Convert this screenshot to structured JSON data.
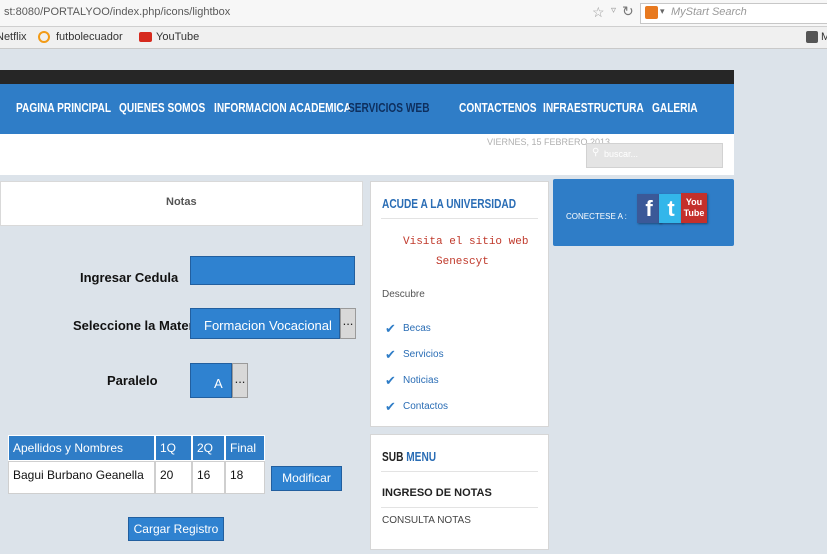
{
  "browser": {
    "url": "st:8080/PORTALYOO/index.php/icons/lightbox",
    "search_placeholder": "MyStart Search",
    "bookmarks": [
      "Netflix",
      "futbolecuador",
      "YouTube",
      "M"
    ]
  },
  "nav": {
    "items": [
      "PAGINA PRINCIPAL",
      "QUIENES SOMOS",
      "INFORMACION ACADEMICA",
      "SERVICIOS WEB",
      "CONTACTENOS",
      "INFRAESTRUCTURA",
      "GALERIA"
    ],
    "active": "SERVICIOS WEB"
  },
  "header": {
    "date": "VIERNES, 15 FEBRERO 2013",
    "search_placeholder": "buscar..."
  },
  "notas": {
    "title": "Notas",
    "cedula_label": "Ingresar Cedula",
    "cedula_value": "",
    "materia_label": "Seleccione la Materia",
    "materia_value": "Formacion Vocacional",
    "more_label": "...",
    "paralelo_label": "Paralelo",
    "paralelo_value": "A",
    "table": {
      "columns": [
        "Apellidos y Nombres",
        "1Q",
        "2Q",
        "Final"
      ],
      "rows": [
        [
          "Bagui Burbano Geanella",
          "20",
          "16",
          "18"
        ]
      ]
    },
    "modificar_label": "Modificar",
    "cargar_label": "Cargar Registro"
  },
  "acude": {
    "title": "ACUDE A LA UNIVERSIDAD",
    "visita_line1": "Visita el sitio web",
    "visita_line2": "Senescyt",
    "descubre": "Descubre",
    "items": [
      "Becas",
      "Servicios",
      "Noticias",
      "Contactos"
    ]
  },
  "submenu": {
    "title_a": "SUB ",
    "title_b": "MENU",
    "items": [
      "INGRESO DE NOTAS",
      "CONSULTA NOTAS"
    ]
  },
  "social": {
    "label": "CONECTESE A :",
    "facebook": "f",
    "twitter": "t",
    "youtube_1": "You",
    "youtube_2": "Tube"
  },
  "colors": {
    "accent": "#2f7dc7",
    "nav_active": "#0e2f5e",
    "link_red": "#c0392b"
  }
}
